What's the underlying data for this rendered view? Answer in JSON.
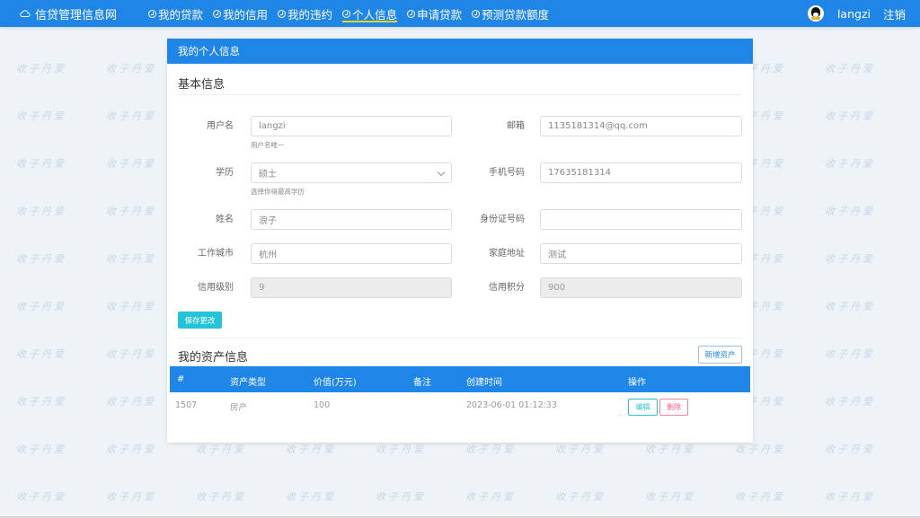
{
  "watermark": "收子丹爱",
  "brand": {
    "title": "信贷管理信息网",
    "icon": "cloud-icon"
  },
  "nav": [
    {
      "label": "我的贷款",
      "active": false
    },
    {
      "label": "我的信用",
      "active": false
    },
    {
      "label": "我的违约",
      "active": false
    },
    {
      "label": "个人信息",
      "active": true
    },
    {
      "label": "申请贷款",
      "active": false
    },
    {
      "label": "预测贷款额度",
      "active": false
    }
  ],
  "user": {
    "name": "langzi",
    "logout": "注销",
    "avatar_icon": "qq-penguin-icon"
  },
  "card": {
    "header": "我的个人信息",
    "basic_title": "基本信息",
    "fields": {
      "username": {
        "label": "用户名",
        "value": "langzi",
        "help": "用户名唯一"
      },
      "email": {
        "label": "邮箱",
        "value": "1135181314@qq.com"
      },
      "education": {
        "label": "学历",
        "value": "硕士",
        "help": "选择你得最高学历"
      },
      "phone": {
        "label": "手机号码",
        "value": "17635181314"
      },
      "name": {
        "label": "姓名",
        "value": "浪子"
      },
      "id_number": {
        "label": "身份证号码",
        "value": ""
      },
      "city": {
        "label": "工作城市",
        "value": "杭州"
      },
      "address": {
        "label": "家庭地址",
        "value": "测试"
      },
      "credit_level": {
        "label": "信用级别",
        "value": "9"
      },
      "credit_points": {
        "label": "信用积分",
        "value": "900"
      }
    },
    "save_button": "保存更改",
    "assets_title": "我的资产信息",
    "add_asset_button": "新增资产",
    "table": {
      "headers": [
        "#",
        "资产类型",
        "价值(万元)",
        "备注",
        "创建时间",
        "操作"
      ],
      "rows": [
        {
          "id": "1507",
          "type": "房产",
          "value": "100",
          "note": "",
          "created": "2023-06-01 01:12:33",
          "edit": "编辑",
          "delete": "删除"
        }
      ]
    }
  },
  "colors": {
    "primary": "#1f86e8",
    "accent_underline": "#f7d51d",
    "save_button": "#25c3d9",
    "delete": "#f06080"
  }
}
